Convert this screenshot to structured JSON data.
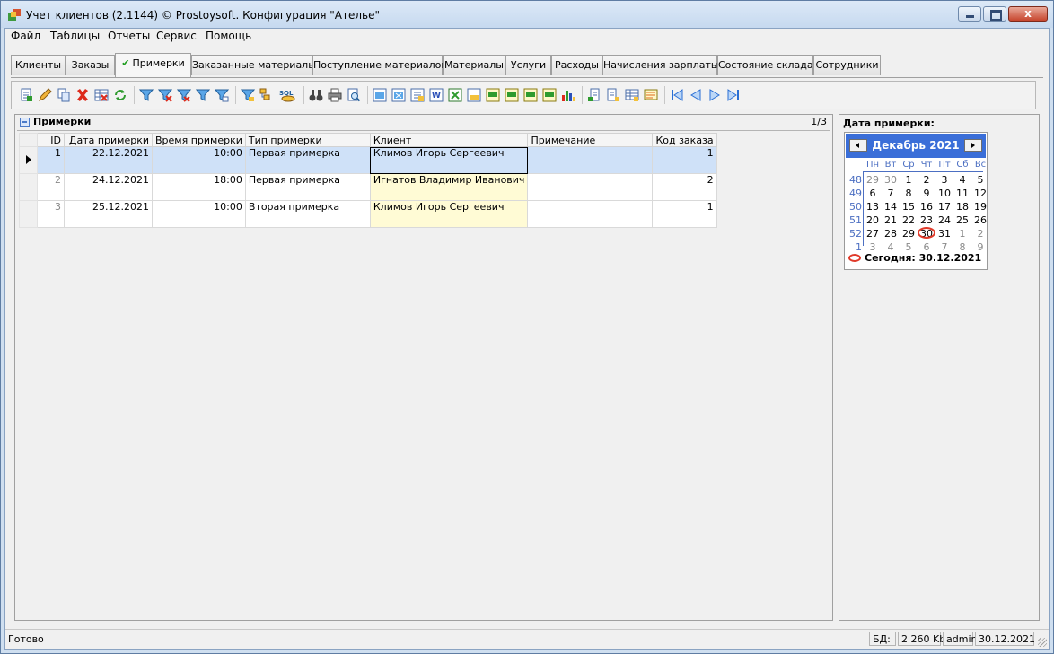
{
  "window": {
    "title": "Учет клиентов (2.1144) © Prostoysoft. Конфигурация \"Ателье\"",
    "controls": {
      "minimize": "minimize",
      "maximize": "maximize",
      "close": "x"
    }
  },
  "menu": [
    "Файл",
    "Таблицы",
    "Отчеты",
    "Сервис",
    "Помощь"
  ],
  "tabs": [
    {
      "label": "Клиенты"
    },
    {
      "label": "Заказы"
    },
    {
      "label": "Примерки",
      "active": true,
      "check": "✔"
    },
    {
      "label": "Заказанные материалы"
    },
    {
      "label": "Поступление материалов"
    },
    {
      "label": "Материалы"
    },
    {
      "label": "Услуги"
    },
    {
      "label": "Расходы"
    },
    {
      "label": "Начисления зарплаты"
    },
    {
      "label": "Состояние склада"
    },
    {
      "label": "Сотрудники"
    }
  ],
  "toolbar": {
    "icons": [
      "add-record-icon",
      "edit-record-icon",
      "copy-record-icon",
      "delete-record-icon",
      "delete-all-icon",
      "refresh-icon",
      "filter-icon",
      "filter-remove-icon",
      "filter-clear-icon",
      "filter-edit-icon",
      "filter-select-icon",
      "sort-icon",
      "group-icon",
      "sql-icon",
      "find-icon",
      "print-icon",
      "print-preview-icon",
      "export-word-icon",
      "export-excel-icon",
      "export-text-icon",
      "export-pdf-icon",
      "export-xml-icon",
      "export-csv-icon",
      "export-html-icon",
      "export-sql-icon",
      "chart-icon",
      "columns-icon",
      "column-settings-icon",
      "layout-icon",
      "properties-icon",
      "first-record-icon",
      "prev-record-icon",
      "next-record-icon",
      "last-record-icon"
    ],
    "sql_label": "SQL"
  },
  "grid": {
    "title": "Примерки",
    "count": "1/3",
    "columns": [
      "ID",
      "Дата примерки",
      "Время примерки",
      "Тип примерки",
      "Клиент",
      "Примечание",
      "Код заказа"
    ],
    "rows": [
      {
        "id": "1",
        "date": "22.12.2021",
        "time": "10:00",
        "type": "Первая примерка",
        "client": "Климов Игорь Сергеевич",
        "note": "",
        "order": "1"
      },
      {
        "id": "2",
        "date": "24.12.2021",
        "time": "18:00",
        "type": "Первая примерка",
        "client": "Игнатов Владимир Иванович",
        "note": "",
        "order": "2"
      },
      {
        "id": "3",
        "date": "25.12.2021",
        "time": "10:00",
        "type": "Вторая примерка",
        "client": "Климов Игорь Сергеевич",
        "note": "",
        "order": "1"
      }
    ]
  },
  "calendar": {
    "label": "Дата примерки:",
    "month_title": "Декабрь 2021",
    "dow": [
      "Пн",
      "Вт",
      "Ср",
      "Чт",
      "Пт",
      "Сб",
      "Вс"
    ],
    "weeks": [
      "48",
      "49",
      "50",
      "51",
      "52",
      "1"
    ],
    "days": [
      [
        "29",
        "30",
        "1",
        "2",
        "3",
        "4",
        "5"
      ],
      [
        "6",
        "7",
        "8",
        "9",
        "10",
        "11",
        "12"
      ],
      [
        "13",
        "14",
        "15",
        "16",
        "17",
        "18",
        "19"
      ],
      [
        "20",
        "21",
        "22",
        "23",
        "24",
        "25",
        "26"
      ],
      [
        "27",
        "28",
        "29",
        "30",
        "31",
        "1",
        "2"
      ],
      [
        "3",
        "4",
        "5",
        "6",
        "7",
        "8",
        "9"
      ]
    ],
    "today_label": "Сегодня: 30.12.2021"
  },
  "status": {
    "text": "Готово",
    "db_label": "БД:",
    "db_size": "2 260 Kb",
    "user": "admin",
    "date": "30.12.2021"
  }
}
